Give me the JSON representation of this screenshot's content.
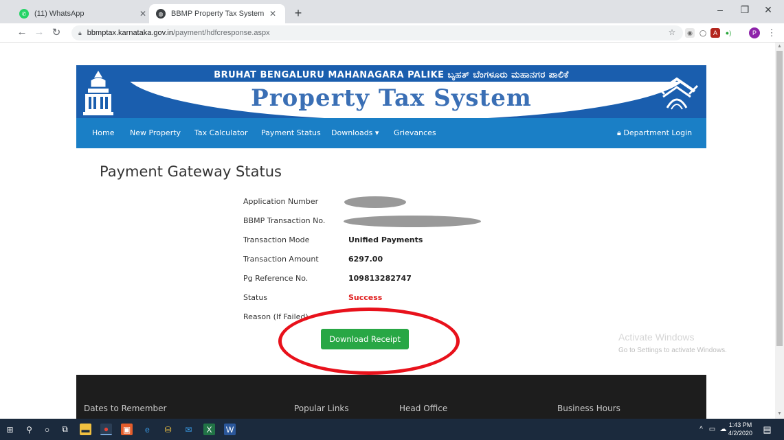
{
  "browser": {
    "tabs": [
      {
        "title": "(11) WhatsApp",
        "favicon": "whatsapp-icon",
        "active": false
      },
      {
        "title": "BBMP Property Tax System",
        "favicon": "globe-icon",
        "active": true
      }
    ],
    "url_host": "bbmptax.karnataka.gov.in",
    "url_path": "/payment/hdfcresponse.aspx"
  },
  "site": {
    "org_name": "BRUHAT BENGALURU MAHANAGARA PALIKE  ಬೃಹತ್ ಬೆಂಗಳೂರು ಮಹಾನಗರ ಪಾಲಿಕೆ",
    "title": "Property Tax System",
    "nav": {
      "home": "Home",
      "new_property": "New Property",
      "tax_calculator": "Tax Calculator",
      "payment_status": "Payment Status",
      "downloads": "Downloads ▾",
      "grievances": "Grievances",
      "department_login": "Department Login"
    }
  },
  "status_page": {
    "heading": "Payment Gateway Status",
    "labels": {
      "application_number": "Application Number",
      "bbmp_transaction_no": "BBMP Transaction No.",
      "transaction_mode": "Transaction Mode",
      "transaction_amount": "Transaction Amount",
      "pg_reference_no": "Pg Reference No.",
      "status": "Status",
      "reason": "Reason (If Failed)"
    },
    "values": {
      "transaction_mode": "Unified Payments",
      "transaction_amount": "6297.00",
      "pg_reference_no": "109813282747",
      "status": "Success"
    },
    "download_button": "Download Receipt"
  },
  "footer": {
    "dates_to_remember": "Dates to Remember",
    "popular_links": "Popular Links",
    "head_office": "Head Office",
    "business_hours": "Business Hours"
  },
  "watermark": {
    "title": "Activate Windows",
    "subtitle": "Go to Settings to activate Windows."
  },
  "taskbar": {
    "time": "1:43 PM",
    "date": "4/2/2020"
  },
  "colors": {
    "header_blue": "#1a5eae",
    "nav_blue": "#1a7fc6",
    "success_red": "#e02020",
    "download_green": "#28a745",
    "annotation_red": "#e8111b"
  }
}
